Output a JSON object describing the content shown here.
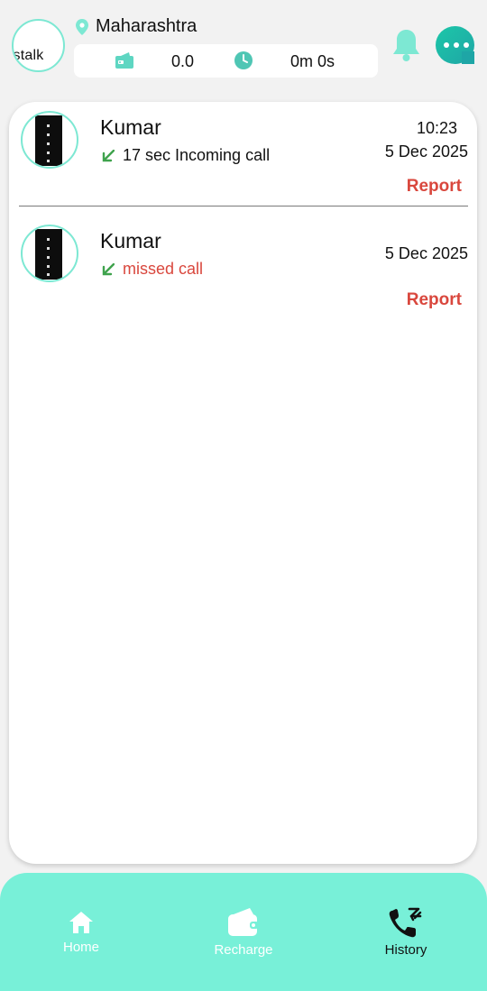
{
  "header": {
    "logo_text": "rstalk",
    "location": "Maharashtra",
    "balance": "0.0",
    "duration": "0m 0s",
    "icons": [
      "location-pin-icon",
      "wallet-icon",
      "clock-icon",
      "bell-icon",
      "chat-icon"
    ],
    "accent_color": "#7de8d3"
  },
  "history": {
    "items": [
      {
        "name": "Kumar",
        "status": "17 sec Incoming call",
        "time": "10:23",
        "date": "5 Dec 2025",
        "report_label": "Report",
        "missed": false
      },
      {
        "name": "Kumar",
        "status": "missed call",
        "time": "",
        "date": "5 Dec 2025",
        "report_label": "Report",
        "missed": true
      }
    ]
  },
  "nav": {
    "items": [
      {
        "label": "Home",
        "icon": "home-icon"
      },
      {
        "label": "Recharge",
        "icon": "wallet-icon"
      },
      {
        "label": "History",
        "icon": "call-history-icon",
        "active": true
      }
    ],
    "background": "#78f0d8"
  },
  "colors": {
    "missed": "#d9473d",
    "incoming_arrow": "#3fa34d",
    "report": "#d9473d"
  }
}
